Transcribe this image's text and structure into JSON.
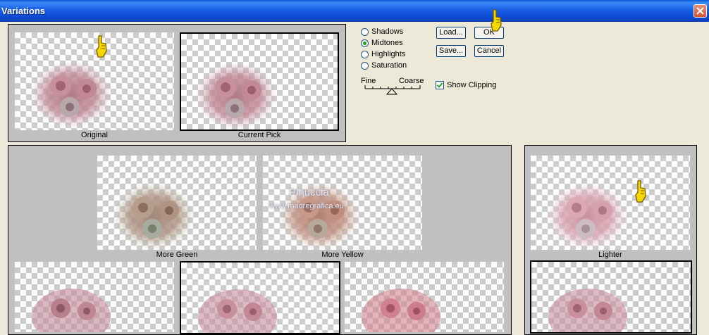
{
  "window": {
    "title": "Variations"
  },
  "panels": {
    "original": {
      "label": "Original"
    },
    "current_pick": {
      "label": "Current Pick"
    },
    "more_green": {
      "label": "More Green"
    },
    "more_yellow": {
      "label": "More Yellow"
    },
    "lighter": {
      "label": "Lighter"
    }
  },
  "tones": [
    {
      "label": "Shadows",
      "selected": false
    },
    {
      "label": "Midtones",
      "selected": true
    },
    {
      "label": "Highlights",
      "selected": false
    },
    {
      "label": "Saturation",
      "selected": false
    }
  ],
  "slider": {
    "fine_label": "Fine",
    "coarse_label": "Coarse"
  },
  "buttons": {
    "load": "Load...",
    "ok": "OK",
    "save": "Save...",
    "cancel": "Cancel"
  },
  "show_clipping": {
    "label": "Show Clipping",
    "checked": true
  },
  "watermark": {
    "line1": "Pinuccia",
    "line2": "www.madregrafica.eu"
  },
  "colors": {
    "titlebar": "#0a56d6",
    "dialog_bg": "#ece9d8",
    "panel_bg": "#c0c0c0",
    "radio_dot": "#21a121"
  }
}
